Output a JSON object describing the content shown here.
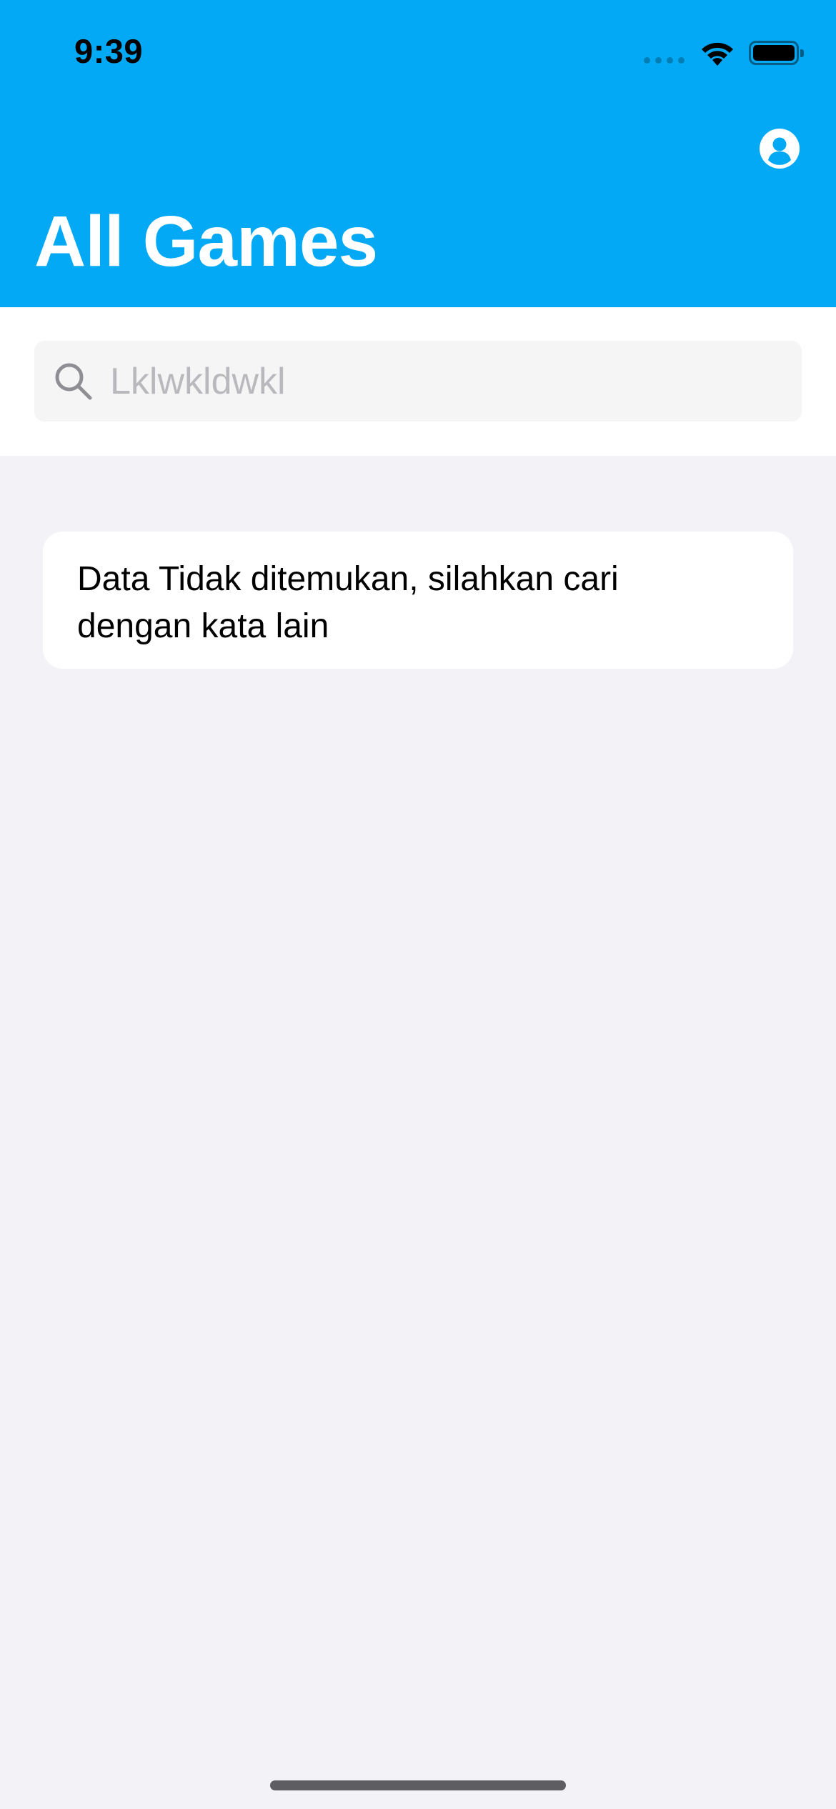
{
  "status_bar": {
    "time": "9:39"
  },
  "header": {
    "title": "All Games",
    "background_color": "#03a9f4",
    "profile_icon": "person-circle-icon"
  },
  "search": {
    "value": "Lklwkldwkl",
    "icon": "magnifying-glass-icon"
  },
  "empty_state": {
    "message": "Data Tidak ditemukan, silahkan cari dengan kata lain"
  }
}
